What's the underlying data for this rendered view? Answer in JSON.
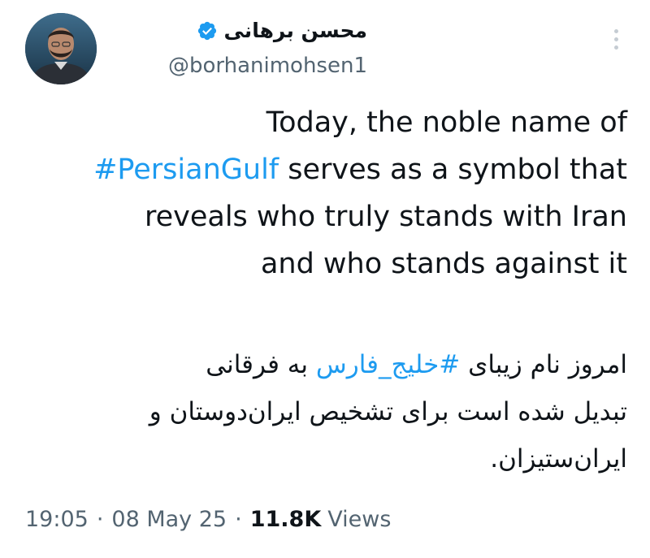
{
  "author": {
    "display_name": "محسن برهانی",
    "handle": "@borhanimohsen1",
    "verified": true,
    "avatar_icon": "profile-photo"
  },
  "tweet": {
    "en_line1": "Today, the noble name of",
    "en_hashtag": "#PersianGulf",
    "en_line2_rest": " serves as a symbol that",
    "en_line3": "reveals who truly stands with Iran",
    "en_line4": "and who stands against it",
    "fa_line1_start": "امروز نام زیبای ",
    "fa_hashtag": "#خلیج_فارس",
    "fa_line1_end": " به فرقانی",
    "fa_line2": "تبدیل شده است برای تشخیص ایران‌دوستان و",
    "fa_line3": "ایران‌ستیزان."
  },
  "meta": {
    "time": "19:05",
    "separator": "·",
    "date": "08 May 25",
    "views_count": "11.8K",
    "views_label": "Views"
  },
  "colors": {
    "link": "#1d9bf0",
    "secondary_text": "#536471",
    "verified_badge": "#1d9bf0"
  },
  "icons": {
    "menu": "more-vertical-icon",
    "verified": "verified-badge-icon"
  }
}
